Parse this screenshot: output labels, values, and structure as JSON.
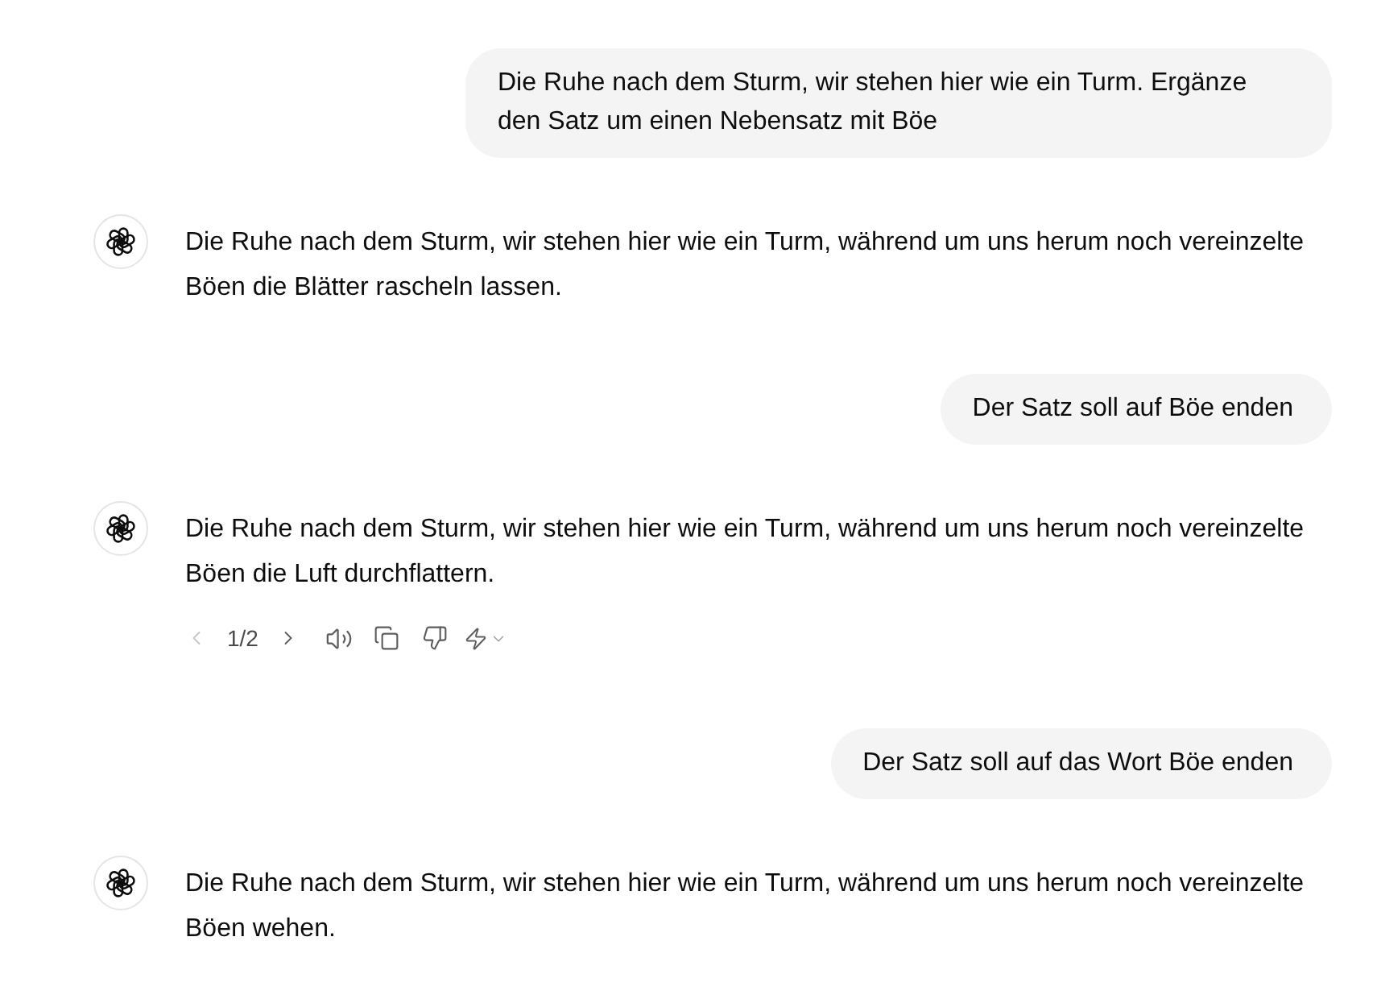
{
  "messages": [
    {
      "kind": "user",
      "text": "Die Ruhe nach dem Sturm, wir stehen hier wie ein Turm. Ergänze den Satz um einen Nebensatz mit Böe"
    },
    {
      "kind": "assistant",
      "text": "Die Ruhe nach dem Sturm, wir stehen hier wie ein Turm, während um uns herum noch vereinzelte Böen die Blätter rascheln lassen."
    },
    {
      "kind": "user",
      "text": "Der Satz soll auf Böe enden"
    },
    {
      "kind": "assistant",
      "text": "Die Ruhe nach dem Sturm, wir stehen hier wie ein Turm, während um uns herum noch vereinzelte Böen die Luft durchflattern.",
      "pager": {
        "label": "1/2",
        "previous_disabled": true,
        "next_disabled": false
      }
    },
    {
      "kind": "user",
      "text": "Der Satz soll auf das Wort Böe enden"
    },
    {
      "kind": "assistant",
      "text": "Die Ruhe nach dem Sturm, wir stehen hier wie ein Turm, während um uns herum noch vereinzelte Böen wehen."
    }
  ]
}
